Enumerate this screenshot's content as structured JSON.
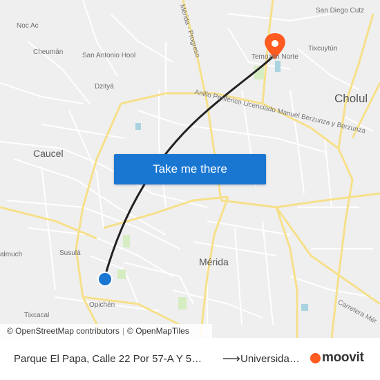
{
  "map": {
    "places": {
      "noc_ac": "Noc Ac",
      "cheuman": "Cheumán",
      "san_antonio_hool": "San Antonio Hool",
      "dzitya": "Dzityá",
      "caucel": "Caucel",
      "susula": "Susulá",
      "almuch": "almuch",
      "opichen": "Opichén",
      "tixcacal": "Tixcacal",
      "merida": "Mérida",
      "temozon_norte": "Temozón Norte",
      "tixcuytun": "Tixcuytún",
      "cholul": "Cholul",
      "san_diego_cutz": "San Diego Cutz"
    },
    "roads": {
      "merida_progreso": "Mérida - Progreso",
      "anillo": "Anillo Periférico Licenciado Manuel Berzunza y Berzunza",
      "carretera": "Carretera Mér"
    },
    "colors": {
      "route": "#222222",
      "origin": "#1977d2",
      "destination": "#ff5a1f",
      "road_major": "#f6e08a",
      "background": "#efefef"
    }
  },
  "cta": {
    "label": "Take me there"
  },
  "attribution": {
    "osm": "© OpenStreetMap contributors",
    "sep": "|",
    "omt": "© OpenMapTiles"
  },
  "footer": {
    "from": "Parque El Papa, Calle 22 Por 57-A Y 5…",
    "arrow": "⟶",
    "to": "Universida…",
    "logo": "moovit"
  }
}
